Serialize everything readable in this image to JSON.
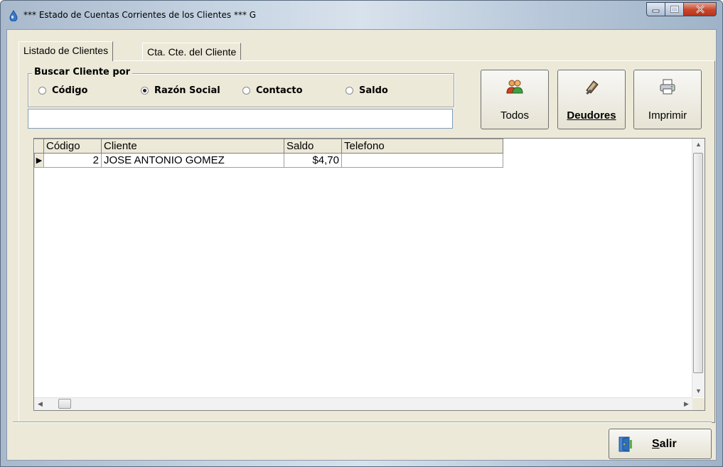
{
  "window": {
    "title": "*** Estado de Cuentas Corrientes de los Clientes *** G"
  },
  "tabs": [
    {
      "label": "Listado de Clientes",
      "active": true
    },
    {
      "label": "Cta. Cte. del Cliente",
      "active": false
    }
  ],
  "search": {
    "group_label": "Buscar Cliente por",
    "options": [
      {
        "label": "Código",
        "selected": false
      },
      {
        "label": "Razón Social",
        "selected": true
      },
      {
        "label": "Contacto",
        "selected": false
      },
      {
        "label": "Saldo",
        "selected": false
      }
    ],
    "value": ""
  },
  "toolbar": {
    "todos_label": "Todos",
    "deudores_label": "Deudores",
    "imprimir_label": "Imprimir"
  },
  "grid": {
    "columns": [
      "Código",
      "Cliente",
      "Saldo",
      "Telefono"
    ],
    "rows": [
      {
        "codigo": "2",
        "cliente": "JOSE ANTONIO GOMEZ",
        "saldo": "$4,70",
        "telefono": ""
      }
    ]
  },
  "footer": {
    "salir_label": "Salir"
  },
  "colors": {
    "face": "#ece9d8",
    "close_button": "#c7452b"
  },
  "icons": [
    "app-icon",
    "minimize-icon",
    "maximize-icon",
    "close-icon",
    "users-icon",
    "deudores-icon",
    "printer-icon",
    "exit-door-icon"
  ]
}
